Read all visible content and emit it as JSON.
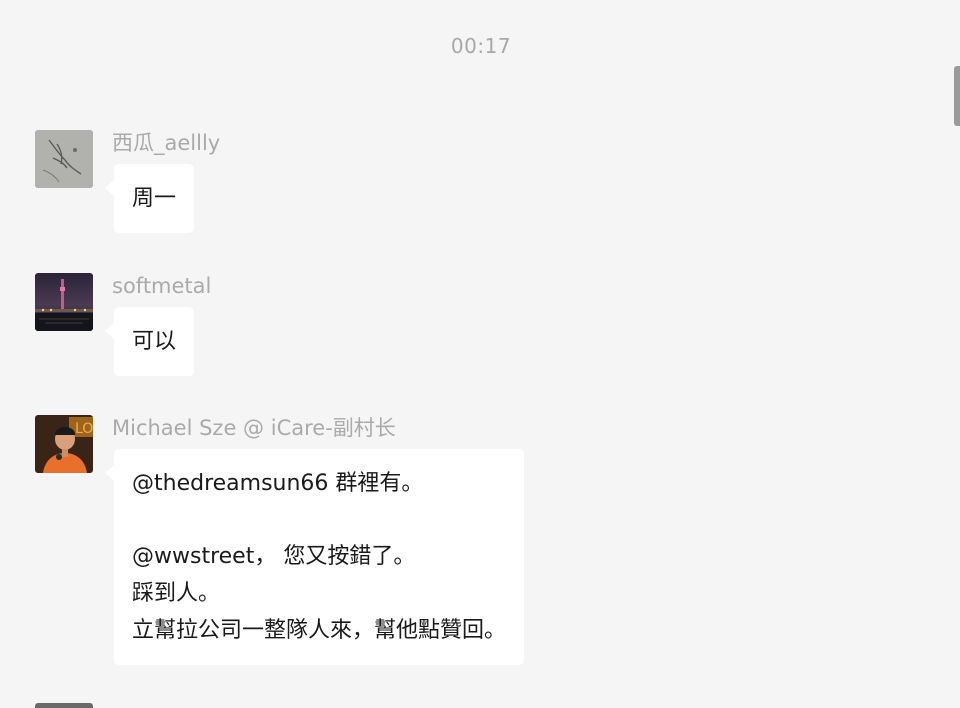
{
  "chat": {
    "timestamp": "00:17",
    "messages": [
      {
        "sender": "西瓜_aellly",
        "avatar_icon": "sketch-avatar",
        "lines": [
          "周一"
        ]
      },
      {
        "sender": "softmetal",
        "avatar_icon": "night-tower-avatar",
        "lines": [
          "可以"
        ]
      },
      {
        "sender": "Michael Sze @ iCare-副村长",
        "avatar_icon": "person-avatar",
        "lines": [
          "@thedreamsun66 群裡有。",
          "",
          "@wwstreet， 您又按錯了。",
          "踩到人。",
          "立幫拉公司一整隊人來，幫他點贊回。"
        ]
      }
    ]
  },
  "colors": {
    "background": "#f5f5f5",
    "bubble": "#ffffff",
    "meta_text": "#aaaaaa",
    "message_text": "#1a1a1a"
  }
}
